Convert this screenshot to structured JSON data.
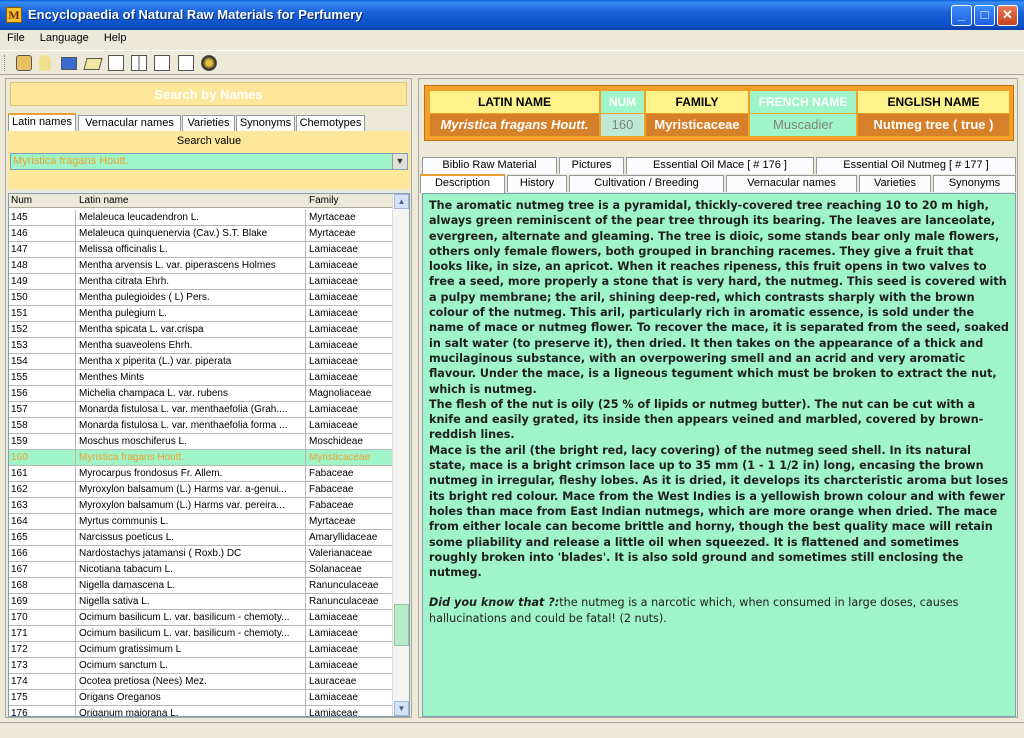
{
  "window": {
    "title": "Encyclopaedia of Natural Raw Materials for Perfumery",
    "icon_letter": "M"
  },
  "menu": [
    "File",
    "Language",
    "Help"
  ],
  "left": {
    "search_banner": "Search by Names",
    "tabs": [
      "Latin names",
      "Vernacular names",
      "Varieties",
      "Synonyms",
      "Chemotypes"
    ],
    "search_value_label": "Search value",
    "search_value": "Myristica fragans Houtt.",
    "columns": [
      "Num",
      "Latin name",
      "Family"
    ],
    "rows": [
      [
        "145",
        "Melaleuca leucadendron L.",
        "Myrtaceae"
      ],
      [
        "146",
        "Melaleuca quinquenervia (Cav.) S.T. Blake",
        "Myrtaceae"
      ],
      [
        "147",
        "Melissa officinalis L.",
        "Lamiaceae"
      ],
      [
        "148",
        "Mentha arvensis L. var. piperascens Holmes",
        "Lamiaceae"
      ],
      [
        "149",
        "Mentha citrata Ehrh.",
        "Lamiaceae"
      ],
      [
        "150",
        "Mentha pulegioides ( L) Pers.",
        "Lamiaceae"
      ],
      [
        "151",
        "Mentha pulegium L.",
        "Lamiaceae"
      ],
      [
        "152",
        "Mentha spicata L. var.crispa",
        "Lamiaceae"
      ],
      [
        "153",
        "Mentha suaveolens Ehrh.",
        "Lamiaceae"
      ],
      [
        "154",
        "Mentha x  piperita (L.) var. piperata",
        "Lamiaceae"
      ],
      [
        "155",
        "Menthes Mints",
        "Lamiaceae"
      ],
      [
        "156",
        "Michelia champaca L. var. rubens",
        "Magnoliaceae"
      ],
      [
        "157",
        "Monarda fistulosa L. var. menthaefolia (Grah....",
        "Lamiaceae"
      ],
      [
        "158",
        "Monarda fistulosa L. var. menthaefolia forma ...",
        "Lamiaceae"
      ],
      [
        "159",
        "Moschus moschiferus L.",
        "Moschideae"
      ],
      [
        "160",
        "Myristica fragans Houtt.",
        "Myristicaceae"
      ],
      [
        "161",
        "Myrocarpus frondosus Fr. Allem.",
        "Fabaceae"
      ],
      [
        "162",
        "Myroxylon balsamum (L.) Harms var. a-genui...",
        "Fabaceae"
      ],
      [
        "163",
        "Myroxylon balsamum (L.) Harms var. pereira...",
        "Fabaceae"
      ],
      [
        "164",
        "Myrtus communis L.",
        "Myrtaceae"
      ],
      [
        "165",
        "Narcissus poeticus L.",
        "Amaryllidaceae"
      ],
      [
        "166",
        "Nardostachys jatamansi  ( Roxb.) DC",
        "Valerianaceae"
      ],
      [
        "167",
        "Nicotiana tabacum L.",
        "Solanaceae"
      ],
      [
        "168",
        "Nigella damascena L.",
        "Ranunculaceae"
      ],
      [
        "169",
        "Nigella sativa L.",
        "Ranunculaceae"
      ],
      [
        "170",
        "Ocimum basilicum L. var. basilicum - chemoty...",
        "Lamiaceae"
      ],
      [
        "171",
        "Ocimum basilicum L. var. basilicum - chemoty...",
        "Lamiaceae"
      ],
      [
        "172",
        "Ocimum gratissimum L",
        "Lamiaceae"
      ],
      [
        "173",
        "Ocimum sanctum L.",
        "Lamiaceae"
      ],
      [
        "174",
        "Ocotea pretiosa (Nees) Mez.",
        "Lauraceae"
      ],
      [
        "175",
        "Origans Oreganos",
        "Lamiaceae"
      ],
      [
        "176",
        "Origanum majorana L.",
        "Lamiaceae"
      ]
    ],
    "selected_row": "160"
  },
  "info": {
    "headers": [
      "LATIN NAME",
      "NUM",
      "FAMILY",
      "FRENCH NAME",
      "ENGLISH NAME"
    ],
    "values": [
      "Myristica fragans Houtt.",
      "160",
      "Myristicaceae",
      "Muscadier",
      "Nutmeg tree ( true )"
    ]
  },
  "tabs_row1": [
    "Biblio Raw Material",
    "Pictures",
    "Essential Oil Mace [ # 176 ]",
    "Essential Oil Nutmeg [ # 177 ]"
  ],
  "tabs_row2": [
    "Description",
    "History",
    "Cultivation / Breeding",
    "Vernacular names",
    "Varieties",
    "Synonyms"
  ],
  "description": {
    "p1": "The aromatic nutmeg tree is a pyramidal, thickly-covered tree reaching 10 to 20 m high, always green reminiscent of the pear tree through its bearing. The leaves are lanceolate, evergreen, alternate and gleaming. The tree is dioic, some stands bear only male flowers, others only female flowers, both grouped in branching racemes. They give a fruit that looks like, in size, an apricot. When it reaches ripeness, this fruit opens in two valves to free a seed, more properly a stone that is very hard, the nutmeg. This seed is covered with a pulpy membrane; the aril, shining deep-red, which contrasts sharply with the brown colour of the nutmeg. This aril, particularly rich in aromatic essence, is sold under the name of mace or nutmeg flower. To recover the mace, it is separated from the seed, soaked in salt water (to preserve it), then dried. It then takes on the appearance of a thick and mucilaginous substance, with an overpowering smell and an acrid and very aromatic flavour. Under the mace, is a ligneous tegument which must be broken to extract the nut, which is nutmeg.",
    "p2": "The flesh of the nut is oily (25 % of lipids or nutmeg butter). The nut can be cut with a knife and easily grated, its inside then appears veined and marbled, covered by brown-reddish lines.",
    "p3": "Mace is the aril (the bright red, lacy covering) of the nutmeg seed shell. In its natural state, mace is a bright crimson lace up to 35 mm (1 - 1 1/2 in) long, encasing the brown nutmeg in irregular, fleshy lobes. As it is dried, it develops its charcteristic aroma but loses its bright red colour. Mace from the West Indies is a yellowish brown colour and with fewer holes than mace from East Indian nutmegs, which are more orange when dried. The mace from either locale can become brittle and horny, though the best quality mace will retain some pliability and release a little oil when squeezed. It is flattened and sometimes roughly broken into 'blades'. It is also sold ground and sometimes still enclosing the nutmeg.",
    "dyk_label": "Did you know that ?:",
    "dyk_text": "the nutmeg is a narcotic which, when consumed in large doses, causes hallucinations and could be fatal! (2 nuts)."
  },
  "toolbar_icons": [
    "person-icon",
    "pin-icon",
    "book-icon",
    "notepad-icon",
    "frame-icon",
    "columns-icon",
    "expand-icon",
    "window-icon",
    "globe-icon"
  ]
}
